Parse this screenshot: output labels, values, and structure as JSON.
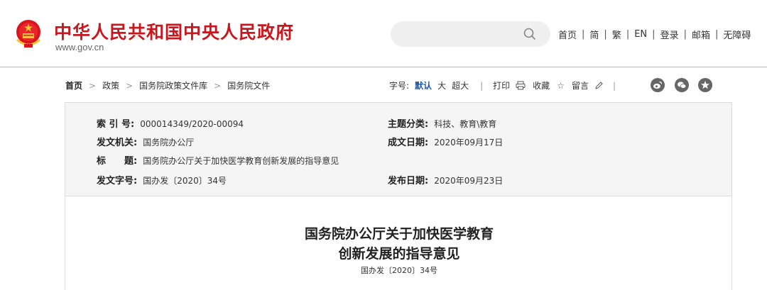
{
  "header": {
    "site_title": "中华人民共和国中央人民政府",
    "site_url": "www.gov.cn",
    "search_placeholder": "",
    "links": [
      "首页",
      "简",
      "繁",
      "EN",
      "登录",
      "邮箱",
      "无障碍"
    ],
    "link_separator": "|",
    "brand_color": "#c8171e"
  },
  "breadcrumb": {
    "items": [
      "首页",
      "政策",
      "国务院政策文件库",
      "国务院文件"
    ],
    "arrow": ">"
  },
  "tools": {
    "font_size_label": "字号:",
    "font_sizes": [
      "默认",
      "大",
      "超大"
    ],
    "active_font_size": "默认",
    "separator": "|",
    "print_label": "打印",
    "print_icon": "printer-icon",
    "favorite_label": "收藏",
    "favorite_icon": "star-icon",
    "comment_label": "留言",
    "comment_icon": "pencil-icon",
    "social_icons": [
      "weibo-icon",
      "wechat-icon",
      "favorite-circle-icon"
    ]
  },
  "info": {
    "index_label": "索 引 号:",
    "index_value": "000014349/2020-00094",
    "category_label": "主题分类:",
    "category_value": "科技、教育\\教育",
    "issuer_label": "发文机关:",
    "issuer_value": "国务院办公厅",
    "date_label": "成文日期:",
    "date_value": "2020年09月17日",
    "title_label": "标　　题:",
    "title_value": "国务院办公厅关于加快医学教育创新发展的指导意见",
    "docno_label": "发文字号:",
    "docno_value": "国办发〔2020〕34号",
    "publish_label": "发布日期:",
    "publish_value": "2020年09月23日"
  },
  "content": {
    "title_line1": "国务院办公厅关于加快医学教育",
    "title_line2": "创新发展的指导意见",
    "doc_number": "国办发〔2020〕34号"
  }
}
